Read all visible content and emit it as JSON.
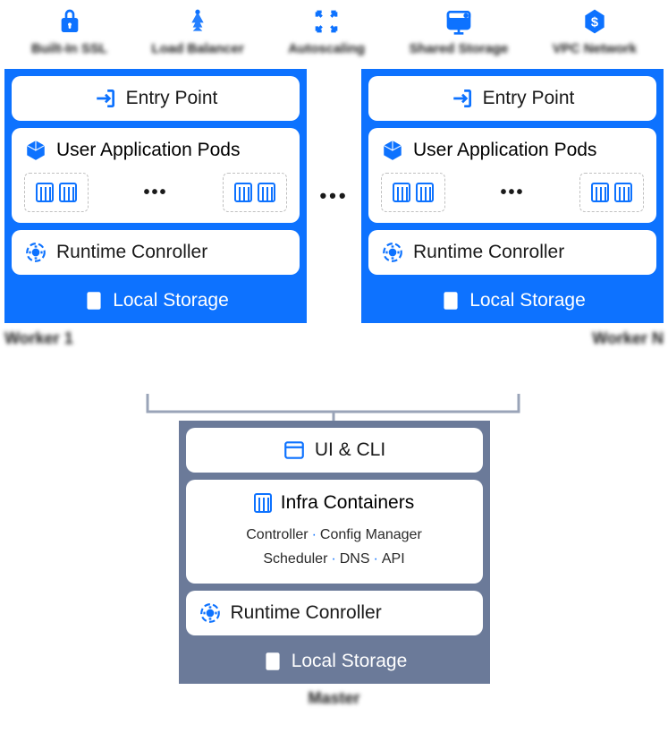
{
  "top_features": [
    {
      "label": "Built-In SSL",
      "icon": "lock-icon"
    },
    {
      "label": "Load Balancer",
      "icon": "balancer-icon"
    },
    {
      "label": "Autoscaling",
      "icon": "autoscale-icon"
    },
    {
      "label": "Shared Storage",
      "icon": "storage-icon"
    },
    {
      "label": "VPC Network",
      "icon": "network-icon"
    }
  ],
  "worker": {
    "entry_point": "Entry Point",
    "pods_title": "User Application Pods",
    "runtime": "Runtime Conroller",
    "local_storage": "Local Storage",
    "label_left": "Worker 1",
    "label_right": "Worker N",
    "dots": "•••",
    "between_dots": "•••"
  },
  "master": {
    "ui_cli": "UI & CLI",
    "infra_title": "Infra Containers",
    "infra_items_line1": [
      "Controller",
      "Config Manager"
    ],
    "infra_items_line2": [
      "Scheduler",
      "DNS",
      "API"
    ],
    "runtime": "Runtime Conroller",
    "local_storage": "Local Storage",
    "label": "Master"
  }
}
